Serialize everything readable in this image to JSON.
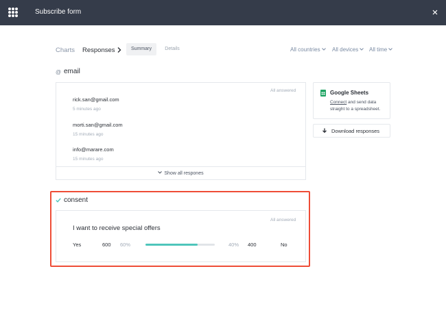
{
  "window": {
    "title": "Subscribe form"
  },
  "nav": {
    "charts": "Charts",
    "responses": "Responses",
    "tabs": [
      "Summary",
      "Details"
    ],
    "active_tab": "Summary"
  },
  "filters": {
    "countries": "All countries",
    "devices": "All devices",
    "time": "All time"
  },
  "email_section": {
    "title": "email",
    "status": "All answered",
    "responses": [
      {
        "value": "rick.san@gmail.com",
        "time": "5 minutes ago"
      },
      {
        "value": "morti.san@gmail.com",
        "time": "15 minutes ago"
      },
      {
        "value": "info@marare.com",
        "time": "15 minutes ago"
      }
    ],
    "show_all": "Show all respones"
  },
  "integrations": {
    "sheets_title": "Google Sheets",
    "sheets_link": "Connect",
    "sheets_desc": " and send data straight to a spreadsheet.",
    "download_label": "Download responses"
  },
  "consent_section": {
    "title": "consent",
    "status": "All answered",
    "question": "I want to receive special offers",
    "yes_label": "Yes",
    "yes_count": "600",
    "yes_percent": "60%",
    "no_percent": "40%",
    "no_count": "400",
    "no_label": "No",
    "yes_share": 0.75
  },
  "colors": {
    "topbar": "#353c4a",
    "accent_bar": "#4ec5bb",
    "highlight": "#ee4c36"
  }
}
